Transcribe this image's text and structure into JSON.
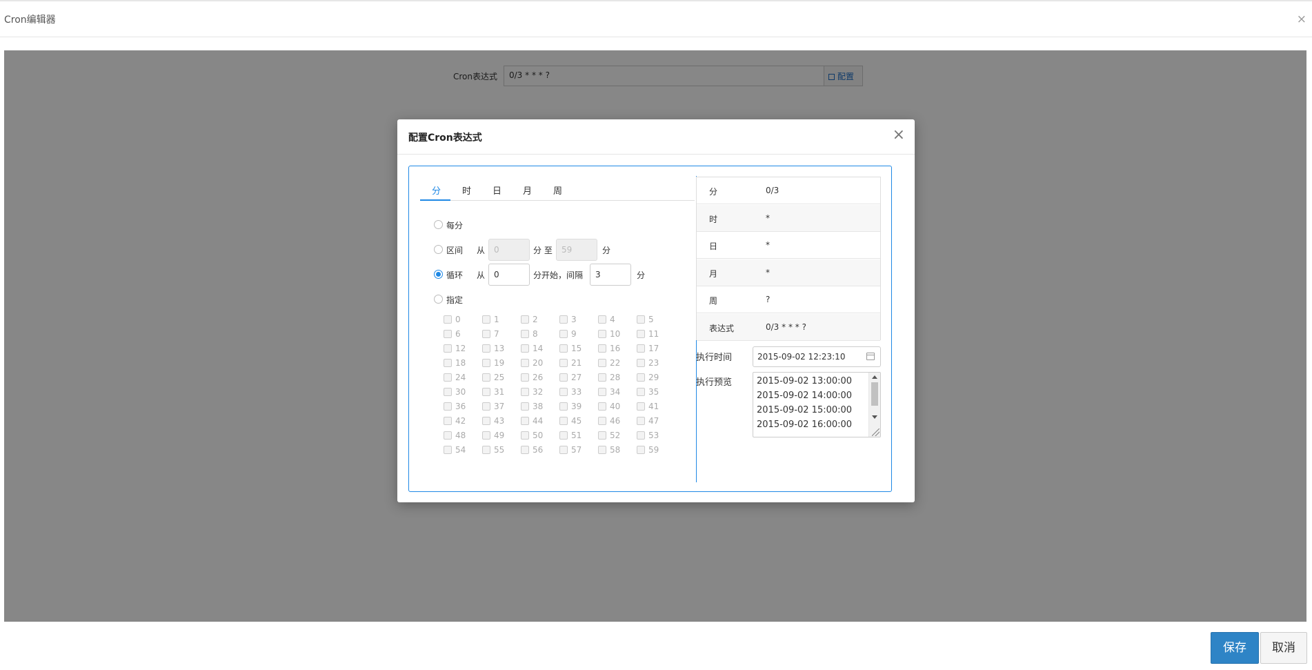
{
  "window": {
    "title": "Cron编辑器"
  },
  "background_form": {
    "label": "Cron表达式",
    "value": "0/3 * * * ?",
    "config_label": "配置"
  },
  "modal": {
    "title": "配置Cron表达式",
    "tabs": [
      "分",
      "时",
      "日",
      "月",
      "周"
    ],
    "active_tab": "分",
    "options": {
      "every_label": "每分",
      "range_label": "区间",
      "range_from": "从",
      "range_start": "0",
      "range_mid": "分 至",
      "range_end": "59",
      "range_unit": "分",
      "loop_label": "循环",
      "loop_from": "从",
      "loop_start": "0",
      "loop_mid": "分开始，间隔",
      "loop_interval": "3",
      "loop_unit": "分",
      "specify_label": "指定"
    },
    "selected_option": "循环",
    "minutes": [
      "0",
      "1",
      "2",
      "3",
      "4",
      "5",
      "6",
      "7",
      "8",
      "9",
      "10",
      "11",
      "12",
      "13",
      "14",
      "15",
      "16",
      "17",
      "18",
      "19",
      "20",
      "21",
      "22",
      "23",
      "24",
      "25",
      "26",
      "27",
      "28",
      "29",
      "30",
      "31",
      "32",
      "33",
      "34",
      "35",
      "36",
      "37",
      "38",
      "39",
      "40",
      "41",
      "42",
      "43",
      "44",
      "45",
      "46",
      "47",
      "48",
      "49",
      "50",
      "51",
      "52",
      "53",
      "54",
      "55",
      "56",
      "57",
      "58",
      "59"
    ],
    "summary": [
      {
        "key": "分",
        "value": "0/3"
      },
      {
        "key": "时",
        "value": "*"
      },
      {
        "key": "日",
        "value": "*"
      },
      {
        "key": "月",
        "value": "*"
      },
      {
        "key": "周",
        "value": "?"
      },
      {
        "key": "表达式",
        "value": "0/3 * * * ?"
      }
    ],
    "exec_time_label": "执行时间",
    "exec_time_value": "2015-09-02 12:23:10",
    "preview_label": "执行预览",
    "preview": [
      "2015-09-02 13:00:00",
      "2015-09-02 14:00:00",
      "2015-09-02 15:00:00",
      "2015-09-02 16:00:00"
    ]
  },
  "footer": {
    "save_label": "保存",
    "cancel_label": "取消"
  },
  "colors": {
    "accent": "#1e88e5",
    "save_button": "#2e84c6",
    "overlay": "rgba(0,0,0,0.47)"
  }
}
